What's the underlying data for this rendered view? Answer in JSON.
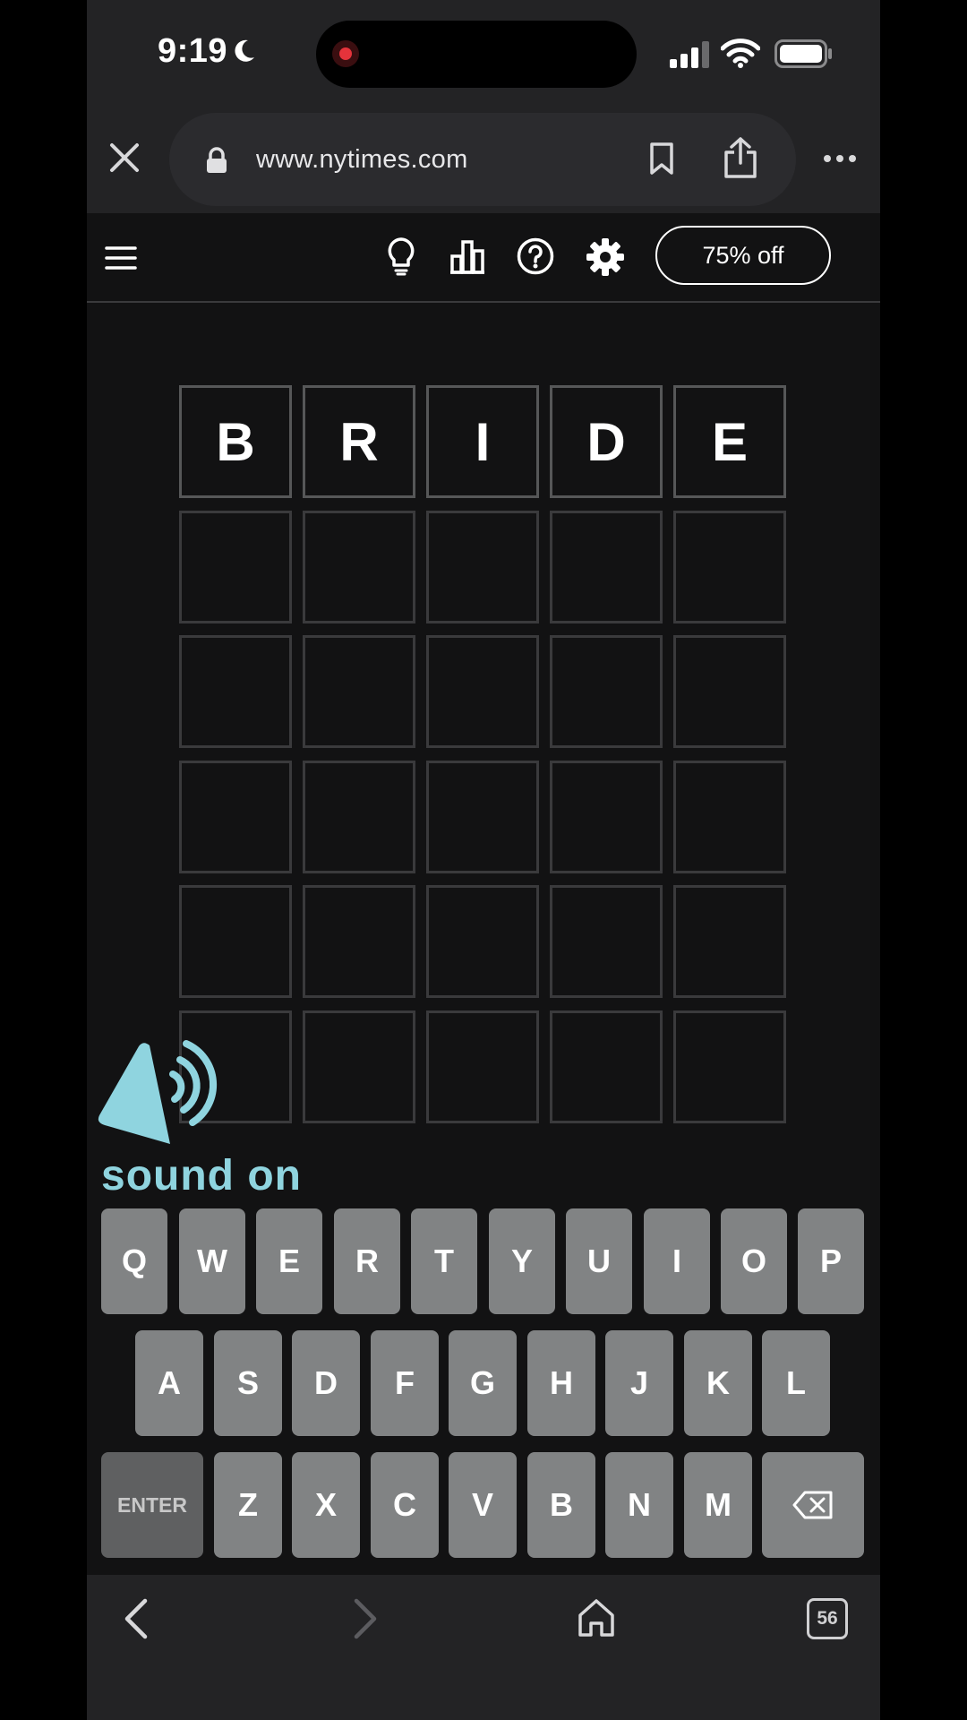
{
  "status_bar": {
    "time": "9:19"
  },
  "browser": {
    "url": "www.nytimes.com"
  },
  "game_header": {
    "promo_label": "75% off"
  },
  "board": {
    "rows": [
      [
        "B",
        "R",
        "I",
        "D",
        "E"
      ],
      [
        "",
        "",
        "",
        "",
        ""
      ],
      [
        "",
        "",
        "",
        "",
        ""
      ],
      [
        "",
        "",
        "",
        "",
        ""
      ],
      [
        "",
        "",
        "",
        "",
        ""
      ],
      [
        "",
        "",
        "",
        "",
        ""
      ]
    ]
  },
  "overlay": {
    "sound_label": "sound on",
    "accent_color": "#8fd4df"
  },
  "keyboard": {
    "row1": [
      "Q",
      "W",
      "E",
      "R",
      "T",
      "Y",
      "U",
      "I",
      "O",
      "P"
    ],
    "row2": [
      "A",
      "S",
      "D",
      "F",
      "G",
      "H",
      "J",
      "K",
      "L"
    ],
    "row3": [
      "ENTER",
      "Z",
      "X",
      "C",
      "V",
      "B",
      "N",
      "M"
    ],
    "backspace_icon": "backspace-icon",
    "key_color": "#818384"
  },
  "toolbar": {
    "tabs_count": "56"
  }
}
